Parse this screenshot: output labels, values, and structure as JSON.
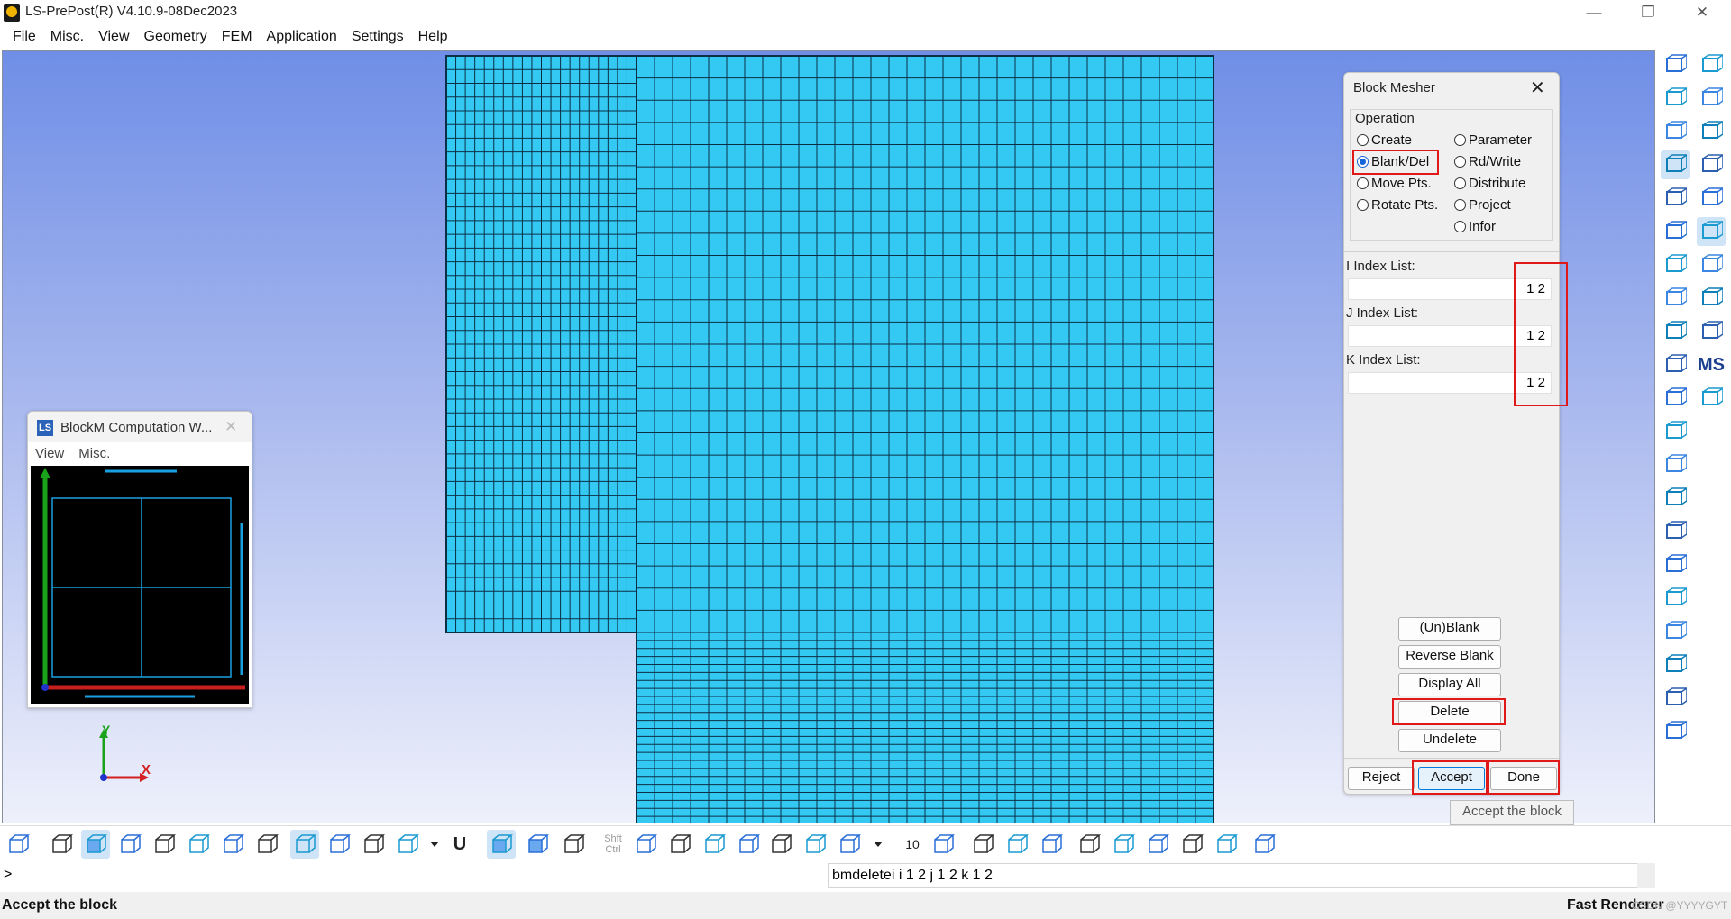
{
  "window": {
    "title": "LS-PrePost(R) V4.10.9-08Dec2023",
    "controls": [
      "minimize-icon",
      "restore-icon",
      "close-icon"
    ],
    "minimize_glyph": "—",
    "restore_glyph": "❐",
    "close_glyph": "✕"
  },
  "menu": [
    "File",
    "Misc.",
    "View",
    "Geometry",
    "FEM",
    "Application",
    "Settings",
    "Help"
  ],
  "blockm_window": {
    "title": "BlockM Computation W...",
    "icon_text": "LS",
    "close_glyph": "✕",
    "menu": [
      "View",
      "Misc."
    ]
  },
  "block_mesher": {
    "title": "Block Mesher",
    "close_glyph": "✕",
    "operation_label": "Operation",
    "options_left": [
      "Create",
      "Blank/Del",
      "Move Pts.",
      "Rotate Pts."
    ],
    "options_right": [
      "Parameter",
      "Rd/Write",
      "Distribute",
      "Project",
      "Infor"
    ],
    "selected": "Blank/Del",
    "i_label": "I Index List:",
    "i_value": "1 2",
    "j_label": "J Index List:",
    "j_value": "1 2",
    "k_label": "K Index List:",
    "k_value": "1 2",
    "buttons": [
      "(Un)Blank",
      "Reverse Blank",
      "Display All",
      "Delete",
      "Undelete"
    ],
    "reject": "Reject",
    "accept": "Accept",
    "done": "Done"
  },
  "tooltip": "Accept the block",
  "axis": {
    "x": "X",
    "y": "Y"
  },
  "bottom_toolbar": {
    "shft": "Shft",
    "ctrl": "Ctrl",
    "u_label": "U",
    "ten": "10"
  },
  "command": {
    "prompt": ">",
    "text": "bmdeletei i 1 2 j 1 2 k 1 2"
  },
  "status": {
    "left": "Accept the block",
    "right": "Fast Renderer",
    "watermark": "CSDN @YYYYGYT"
  },
  "colors": {
    "mesh_fill": "#33c9f2",
    "mesh_line": "#0d2f45",
    "highlight": "#e01818"
  }
}
